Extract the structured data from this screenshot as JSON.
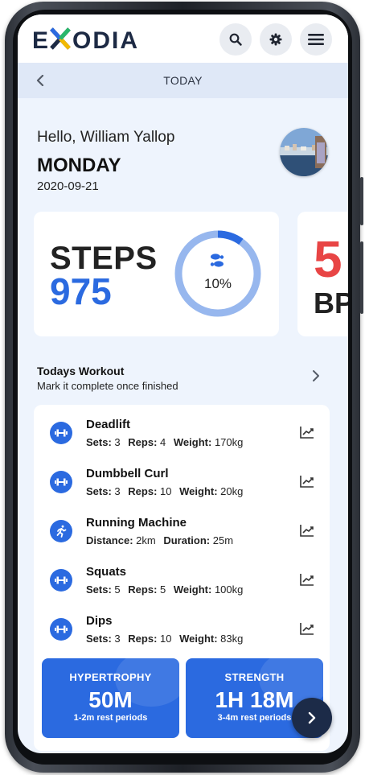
{
  "app": {
    "brand": "EXODIA",
    "accent": "#2b6ae0",
    "bpm_color": "#e84545"
  },
  "header": {
    "icons": [
      "search-icon",
      "gear-icon",
      "menu-icon"
    ]
  },
  "subbar": {
    "title": "TODAY"
  },
  "user": {
    "greeting": "Hello, William Yallop",
    "day": "MONDAY",
    "date": "2020-09-21"
  },
  "steps": {
    "label": "STEPS",
    "value": "975",
    "percent_text": "10%",
    "progress_fraction": 0.1
  },
  "bpm": {
    "value": "5",
    "label": "BP"
  },
  "workout": {
    "title": "Todays Workout",
    "subtitle": "Mark it complete once finished",
    "items": [
      {
        "icon": "dumbbell-icon",
        "name": "Deadlift",
        "f1": "Sets:",
        "v1": "3",
        "f2": "Reps:",
        "v2": "4",
        "f3": "Weight:",
        "v3": "170kg"
      },
      {
        "icon": "dumbbell-icon",
        "name": "Dumbbell Curl",
        "f1": "Sets:",
        "v1": "3",
        "f2": "Reps:",
        "v2": "10",
        "f3": "Weight:",
        "v3": "20kg"
      },
      {
        "icon": "running-icon",
        "name": "Running Machine",
        "f1": "Distance:",
        "v1": "2km",
        "f2": "Duration:",
        "v2": "25m",
        "f3": "",
        "v3": ""
      },
      {
        "icon": "dumbbell-icon",
        "name": "Squats",
        "f1": "Sets:",
        "v1": "5",
        "f2": "Reps:",
        "v2": "5",
        "f3": "Weight:",
        "v3": "100kg"
      },
      {
        "icon": "dumbbell-icon",
        "name": "Dips",
        "f1": "Sets:",
        "v1": "3",
        "f2": "Reps:",
        "v2": "10",
        "f3": "Weight:",
        "v3": "83kg"
      }
    ]
  },
  "tiles": [
    {
      "title": "HYPERTROPHY",
      "value": "50M",
      "note": "1-2m rest periods"
    },
    {
      "title": "STRENGTH",
      "value": "1H 18M",
      "note": "3-4m rest periods"
    }
  ]
}
